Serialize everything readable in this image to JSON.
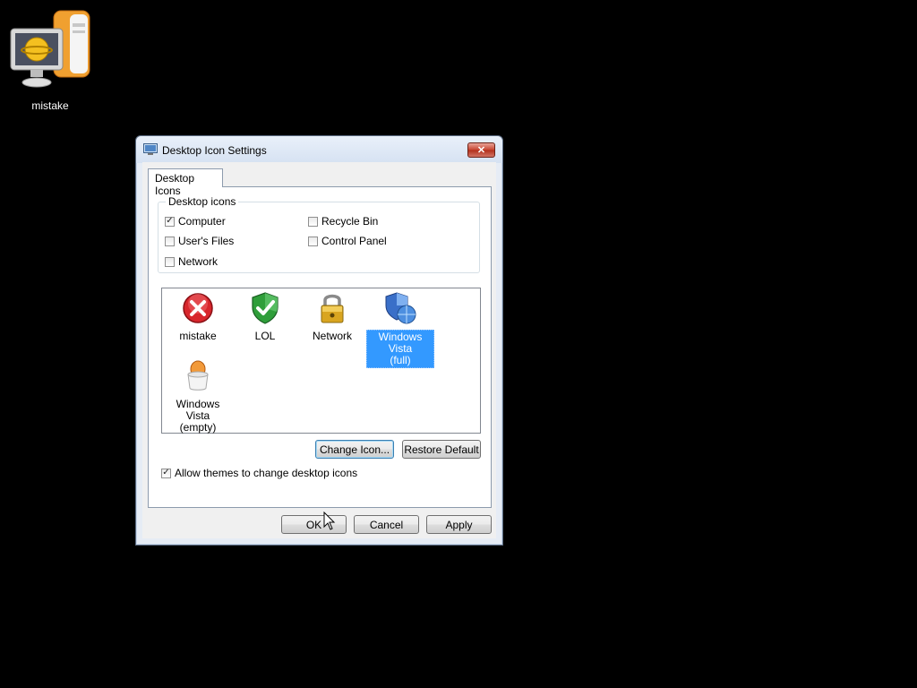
{
  "desktop": {
    "icon_label": "mistake"
  },
  "dialog": {
    "title": "Desktop Icon Settings",
    "close_glyph": "✕",
    "tab_label": "Desktop Icons",
    "group_label": "Desktop icons",
    "checkboxes": [
      {
        "label": "Computer",
        "checked": true
      },
      {
        "label": "Recycle Bin",
        "checked": false
      },
      {
        "label": "User's Files",
        "checked": false
      },
      {
        "label": "Control Panel",
        "checked": false
      },
      {
        "label": "Network",
        "checked": false
      }
    ],
    "icons": [
      {
        "label": "mistake",
        "icon": "red-error-icon",
        "selected": false
      },
      {
        "label": "LOL",
        "icon": "green-shield-check-icon",
        "selected": false
      },
      {
        "label": "Network",
        "icon": "padlock-icon",
        "selected": false
      },
      {
        "label": "Windows Vista (full)",
        "label_line1": "Windows Vista",
        "label_line2": "(full)",
        "icon": "shield-globe-icon",
        "selected": true
      },
      {
        "label": "Windows Vista (empty)",
        "label_line1": "Windows Vista",
        "label_line2": "(empty)",
        "icon": "cup-icon",
        "selected": false
      }
    ],
    "change_icon_label": "Change Icon...",
    "restore_default_label": "Restore Default",
    "allow_themes_label": "Allow themes to change desktop icons",
    "allow_themes_checked": true,
    "ok_label": "OK",
    "cancel_label": "Cancel",
    "apply_label": "Apply"
  },
  "colors": {
    "desktop_bg": "#000000",
    "selection": "#3399ff",
    "close_button": "#c7432f"
  }
}
